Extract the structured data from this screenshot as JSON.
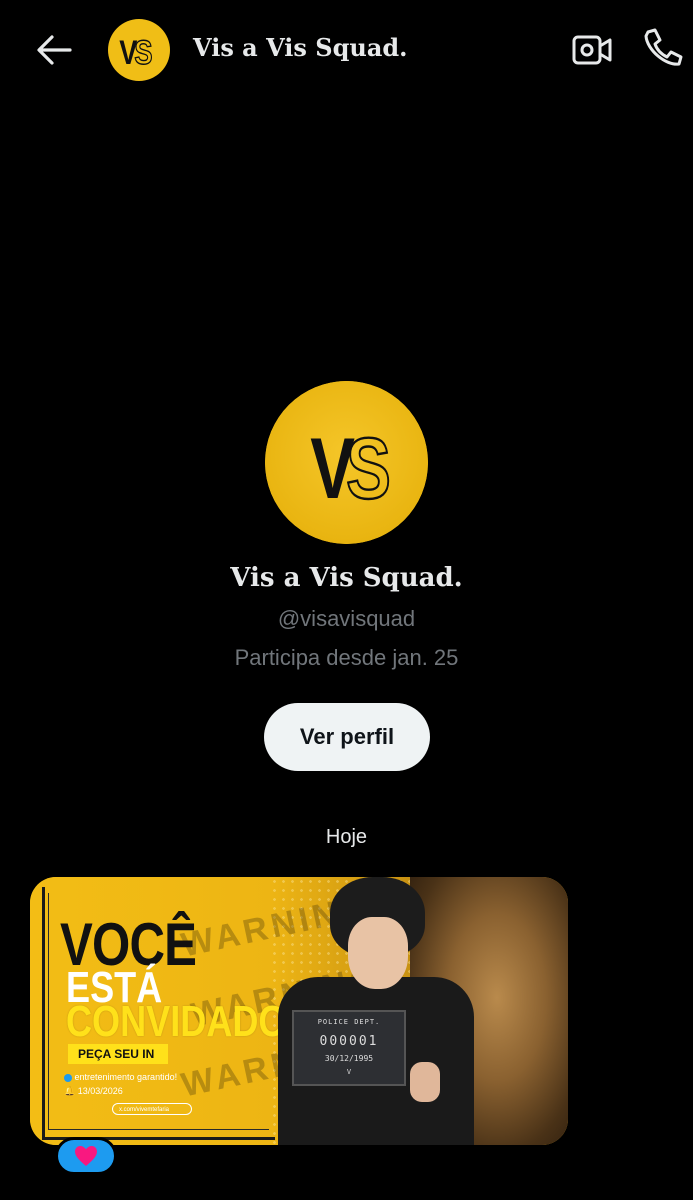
{
  "header": {
    "title": "Vis a Vis Squad.",
    "avatar_monogram": "VS"
  },
  "profile": {
    "name": "Vis a Vis Squad.",
    "handle": "@visavisquad",
    "joined": "Participa desde jan. 25",
    "view_profile_label": "Ver perfil",
    "avatar_monogram": "VS"
  },
  "conversation": {
    "date_separator": "Hoje"
  },
  "media_post": {
    "headline_line1": "VOCÊ",
    "headline_line2": "ESTÁ",
    "headline_line3": "CONVIDADO",
    "cta": "PEÇA SEU IN",
    "tagline": "entretenimento garantido!",
    "date": "13/03/2026",
    "url": "x.com/vivemtefaria",
    "sign_dept": "POLICE DEPT.",
    "sign_number": "000001",
    "sign_date": "30/12/1995",
    "sign_name": "V",
    "tape_text": "WARNING"
  },
  "reaction": {
    "icon": "heart-icon",
    "color": "#f91880"
  },
  "colors": {
    "brand_yellow": "#f0be16",
    "accent_blue": "#1d9bf0",
    "muted_text": "#71767b"
  }
}
